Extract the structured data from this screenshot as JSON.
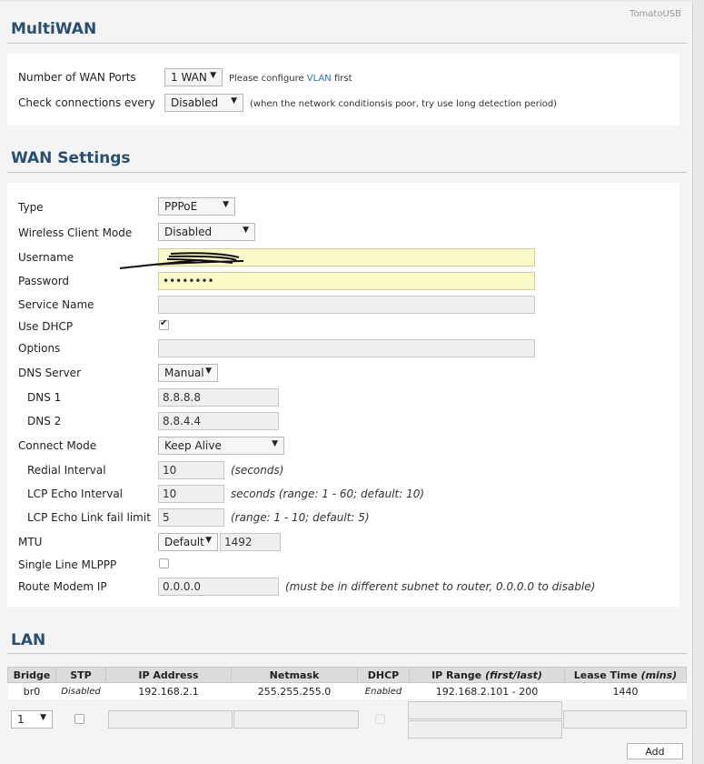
{
  "brand": "TomatoUSB",
  "multiwan": {
    "title": "MultiWAN",
    "wan_ports_label": "Number of WAN Ports",
    "wan_ports_value": "1 WAN",
    "wan_ports_hint_pre": "Please configure ",
    "wan_ports_hint_link": "VLAN",
    "wan_ports_hint_post": " first",
    "check_label": "Check connections every",
    "check_value": "Disabled",
    "check_hint": "(when the network conditionsis poor, try use long detection period)"
  },
  "wan": {
    "title": "WAN Settings",
    "type_label": "Type",
    "type_value": "PPPoE",
    "wireless_label": "Wireless Client Mode",
    "wireless_value": "Disabled",
    "username_label": "Username",
    "username_value": "",
    "password_label": "Password",
    "password_value": "••••••••",
    "service_label": "Service Name",
    "service_value": "",
    "dhcp_label": "Use DHCP",
    "dhcp_checked": true,
    "options_label": "Options",
    "options_value": "",
    "dns_label": "DNS Server",
    "dns_value": "Manual",
    "dns1_label": "DNS 1",
    "dns1_value": "8.8.8.8",
    "dns2_label": "DNS 2",
    "dns2_value": "8.8.4.4",
    "connect_label": "Connect Mode",
    "connect_value": "Keep Alive",
    "redial_label": "Redial Interval",
    "redial_value": "10",
    "redial_hint": "(seconds)",
    "lcp_interval_label": "LCP Echo Interval",
    "lcp_interval_value": "10",
    "lcp_interval_hint": "seconds (range: 1 - 60; default: 10)",
    "lcp_fail_label": "LCP Echo Link fail limit",
    "lcp_fail_value": "5",
    "lcp_fail_hint": "(range: 1 - 10; default: 5)",
    "mtu_label": "MTU",
    "mtu_mode": "Default",
    "mtu_value": "1492",
    "mlppp_label": "Single Line MLPPP",
    "mlppp_checked": false,
    "route_label": "Route Modem IP",
    "route_value": "0.0.0.0",
    "route_hint": "(must be in different subnet to router, 0.0.0.0 to disable)"
  },
  "lan": {
    "title": "LAN",
    "headers": [
      "Bridge",
      "STP",
      "IP Address",
      "Netmask",
      "DHCP",
      "IP Range",
      "(first/last)",
      "Lease Time",
      "(mins)"
    ],
    "row": {
      "bridge": "br0",
      "stp": "Disabled",
      "ip": "192.168.2.1",
      "netmask": "255.255.255.0",
      "dhcp": "Enabled",
      "range": "192.168.2.101 - 200",
      "lease": "1440"
    },
    "new_bridge_value": "1",
    "add_label": "Add"
  }
}
